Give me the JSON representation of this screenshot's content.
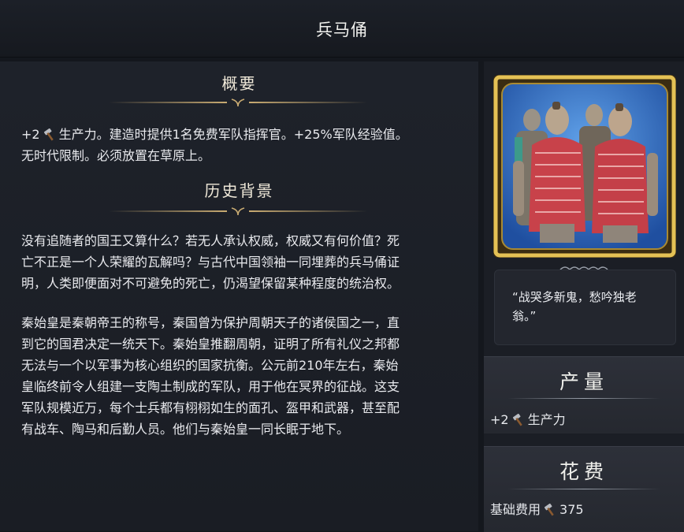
{
  "header": {
    "title": "兵马俑"
  },
  "overview": {
    "title": "概要",
    "text_before_icon": "+2",
    "icon": "hammer-icon",
    "text_line1": "生产力。建造时提供1名免费军队指挥官。+25%军队经验值。",
    "text_line2": "无时代限制。必须放置在草原上。"
  },
  "history": {
    "title": "历史背景",
    "p1": [
      "没有追随者的国王又算什么？若无人承认权威，权威又有何价值？死",
      "亡不正是一个人荣耀的瓦解吗？与古代中国领袖一同埋葬的兵马俑证",
      "明，人类即便面对不可避免的死亡，仍渴望保留某种程度的统治权。"
    ],
    "p2": [
      "秦始皇是秦朝帝王的称号，秦国曾为保护周朝天子的诸侯国之一，直",
      "到它的国君决定一统天下。秦始皇推翻周朝，证明了所有礼仪之邦都",
      "无法与一个以军事为核心组织的国家抗衡。公元前210年左右，秦始",
      "皇临终前令人组建一支陶土制成的军队，用于他在冥界的征战。这支",
      "军队规模近万，每个士兵都有栩栩如生的面孔、盔甲和武器，甚至配",
      "有战车、陶马和后勤人员。他们与秦始皇一同长眠于地下。"
    ]
  },
  "quote": {
    "line1": "“战哭多新鬼，愁吟独老",
    "line2": "翁。”"
  },
  "production": {
    "title": "产量",
    "value": "+2",
    "icon": "hammer-icon",
    "label": "生产力"
  },
  "cost": {
    "title": "花费",
    "label": "基础费用",
    "icon": "hammer-icon",
    "value": "375"
  },
  "colors": {
    "gold": "#c9ab72",
    "frame": "#d9b54a",
    "portrait_bg": "#2f64b8",
    "armor": "#c8424a"
  }
}
